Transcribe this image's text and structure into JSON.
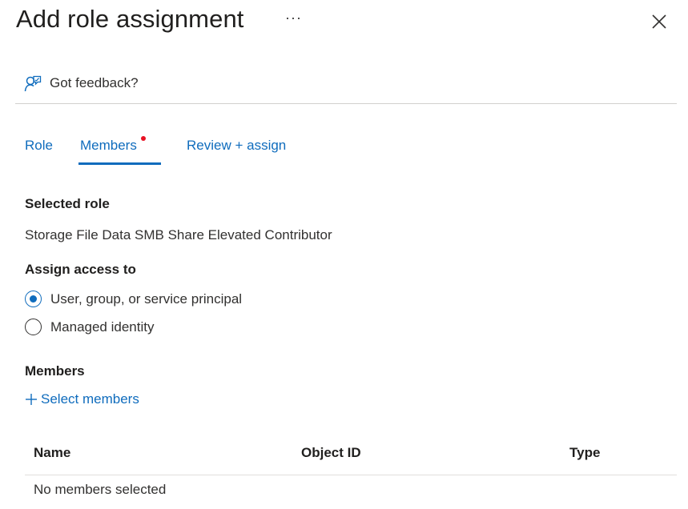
{
  "header": {
    "title": "Add role assignment",
    "more_label": "···",
    "close_icon": "close-icon"
  },
  "feedback": {
    "label": "Got feedback?",
    "icon": "feedback-person-icon"
  },
  "tabs": [
    {
      "label": "Role",
      "active": false
    },
    {
      "label": "Members",
      "active": true,
      "indicator": "red-dot"
    },
    {
      "label": "Review + assign",
      "active": false
    }
  ],
  "selected_role": {
    "heading": "Selected role",
    "value": "Storage File Data SMB Share Elevated Contributor"
  },
  "assign_access": {
    "heading": "Assign access to",
    "options": [
      {
        "label": "User, group, or service principal",
        "checked": true
      },
      {
        "label": "Managed identity",
        "checked": false
      }
    ]
  },
  "members": {
    "heading": "Members",
    "select_label": "Select members",
    "select_icon": "plus-icon",
    "columns": [
      "Name",
      "Object ID",
      "Type"
    ],
    "empty_text": "No members selected"
  },
  "colors": {
    "accent": "#0f6cbd",
    "indicator": "#e81123",
    "text": "#323130",
    "divider": "#d2d0ce"
  }
}
